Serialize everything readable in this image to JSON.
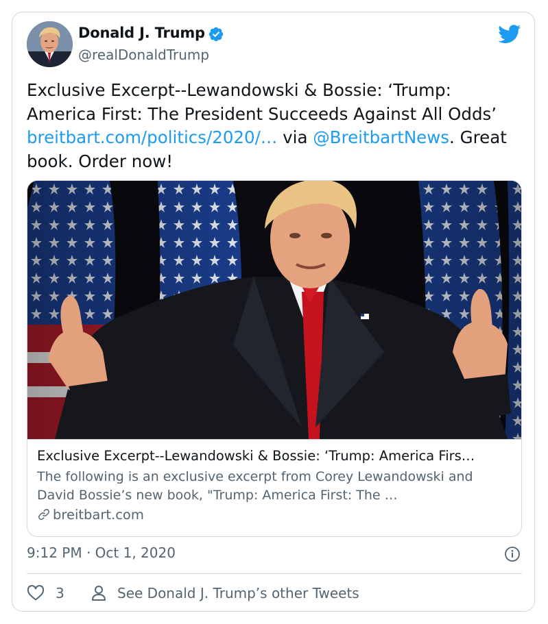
{
  "author": {
    "display_name": "Donald J. Trump",
    "handle": "@realDonaldTrump",
    "verified": true,
    "avatar_icon": "profile-photo"
  },
  "tweet": {
    "text_part1": "Exclusive Excerpt--Lewandowski & Bossie: ‘Trump: America First: The President Succeeds Against All Odds’ ",
    "link_url": "breitbart.com/politics/2020/…",
    "text_part2": " via ",
    "mention": "@BreitbartNews",
    "text_part3": ". Great book. Order now!"
  },
  "link_card": {
    "title": "Exclusive Excerpt--Lewandowski & Bossie: ‘Trump: America Firs…",
    "description": "The following is an exclusive excerpt from Corey Lewandowski and David Bossie’s new book, \"Trump: America First: The …",
    "domain": "breitbart.com"
  },
  "meta": {
    "timestamp": "9:12 PM · Oct 1, 2020"
  },
  "actions": {
    "like_count": "3",
    "profile_link_label": "See Donald J. Trump’s other Tweets"
  },
  "colors": {
    "brand": "#1d9bf0",
    "text_primary": "#0f1419",
    "text_secondary": "#536471",
    "border": "#cfd9de"
  },
  "icons": {
    "brand": "twitter-bird-icon",
    "verified": "verified-badge-icon",
    "info": "info-icon",
    "like": "heart-icon",
    "profile": "person-icon",
    "link": "link-icon"
  }
}
